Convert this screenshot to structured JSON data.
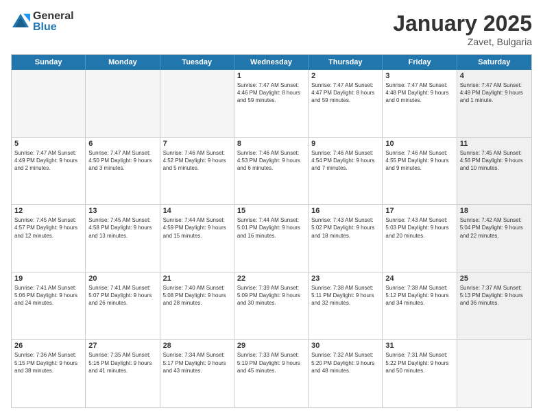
{
  "logo": {
    "general": "General",
    "blue": "Blue"
  },
  "title": "January 2025",
  "subtitle": "Zavet, Bulgaria",
  "days": [
    "Sunday",
    "Monday",
    "Tuesday",
    "Wednesday",
    "Thursday",
    "Friday",
    "Saturday"
  ],
  "weeks": [
    [
      {
        "day": "",
        "info": "",
        "empty": true
      },
      {
        "day": "",
        "info": "",
        "empty": true
      },
      {
        "day": "",
        "info": "",
        "empty": true
      },
      {
        "day": "1",
        "info": "Sunrise: 7:47 AM\nSunset: 4:46 PM\nDaylight: 8 hours\nand 59 minutes."
      },
      {
        "day": "2",
        "info": "Sunrise: 7:47 AM\nSunset: 4:47 PM\nDaylight: 8 hours\nand 59 minutes."
      },
      {
        "day": "3",
        "info": "Sunrise: 7:47 AM\nSunset: 4:48 PM\nDaylight: 9 hours\nand 0 minutes."
      },
      {
        "day": "4",
        "info": "Sunrise: 7:47 AM\nSunset: 4:49 PM\nDaylight: 9 hours\nand 1 minute.",
        "shaded": true
      }
    ],
    [
      {
        "day": "5",
        "info": "Sunrise: 7:47 AM\nSunset: 4:49 PM\nDaylight: 9 hours\nand 2 minutes."
      },
      {
        "day": "6",
        "info": "Sunrise: 7:47 AM\nSunset: 4:50 PM\nDaylight: 9 hours\nand 3 minutes."
      },
      {
        "day": "7",
        "info": "Sunrise: 7:46 AM\nSunset: 4:52 PM\nDaylight: 9 hours\nand 5 minutes."
      },
      {
        "day": "8",
        "info": "Sunrise: 7:46 AM\nSunset: 4:53 PM\nDaylight: 9 hours\nand 6 minutes."
      },
      {
        "day": "9",
        "info": "Sunrise: 7:46 AM\nSunset: 4:54 PM\nDaylight: 9 hours\nand 7 minutes."
      },
      {
        "day": "10",
        "info": "Sunrise: 7:46 AM\nSunset: 4:55 PM\nDaylight: 9 hours\nand 9 minutes."
      },
      {
        "day": "11",
        "info": "Sunrise: 7:45 AM\nSunset: 4:56 PM\nDaylight: 9 hours\nand 10 minutes.",
        "shaded": true
      }
    ],
    [
      {
        "day": "12",
        "info": "Sunrise: 7:45 AM\nSunset: 4:57 PM\nDaylight: 9 hours\nand 12 minutes."
      },
      {
        "day": "13",
        "info": "Sunrise: 7:45 AM\nSunset: 4:58 PM\nDaylight: 9 hours\nand 13 minutes."
      },
      {
        "day": "14",
        "info": "Sunrise: 7:44 AM\nSunset: 4:59 PM\nDaylight: 9 hours\nand 15 minutes."
      },
      {
        "day": "15",
        "info": "Sunrise: 7:44 AM\nSunset: 5:01 PM\nDaylight: 9 hours\nand 16 minutes."
      },
      {
        "day": "16",
        "info": "Sunrise: 7:43 AM\nSunset: 5:02 PM\nDaylight: 9 hours\nand 18 minutes."
      },
      {
        "day": "17",
        "info": "Sunrise: 7:43 AM\nSunset: 5:03 PM\nDaylight: 9 hours\nand 20 minutes."
      },
      {
        "day": "18",
        "info": "Sunrise: 7:42 AM\nSunset: 5:04 PM\nDaylight: 9 hours\nand 22 minutes.",
        "shaded": true
      }
    ],
    [
      {
        "day": "19",
        "info": "Sunrise: 7:41 AM\nSunset: 5:06 PM\nDaylight: 9 hours\nand 24 minutes."
      },
      {
        "day": "20",
        "info": "Sunrise: 7:41 AM\nSunset: 5:07 PM\nDaylight: 9 hours\nand 26 minutes."
      },
      {
        "day": "21",
        "info": "Sunrise: 7:40 AM\nSunset: 5:08 PM\nDaylight: 9 hours\nand 28 minutes."
      },
      {
        "day": "22",
        "info": "Sunrise: 7:39 AM\nSunset: 5:09 PM\nDaylight: 9 hours\nand 30 minutes."
      },
      {
        "day": "23",
        "info": "Sunrise: 7:38 AM\nSunset: 5:11 PM\nDaylight: 9 hours\nand 32 minutes."
      },
      {
        "day": "24",
        "info": "Sunrise: 7:38 AM\nSunset: 5:12 PM\nDaylight: 9 hours\nand 34 minutes."
      },
      {
        "day": "25",
        "info": "Sunrise: 7:37 AM\nSunset: 5:13 PM\nDaylight: 9 hours\nand 36 minutes.",
        "shaded": true
      }
    ],
    [
      {
        "day": "26",
        "info": "Sunrise: 7:36 AM\nSunset: 5:15 PM\nDaylight: 9 hours\nand 38 minutes."
      },
      {
        "day": "27",
        "info": "Sunrise: 7:35 AM\nSunset: 5:16 PM\nDaylight: 9 hours\nand 41 minutes."
      },
      {
        "day": "28",
        "info": "Sunrise: 7:34 AM\nSunset: 5:17 PM\nDaylight: 9 hours\nand 43 minutes."
      },
      {
        "day": "29",
        "info": "Sunrise: 7:33 AM\nSunset: 5:19 PM\nDaylight: 9 hours\nand 45 minutes."
      },
      {
        "day": "30",
        "info": "Sunrise: 7:32 AM\nSunset: 5:20 PM\nDaylight: 9 hours\nand 48 minutes."
      },
      {
        "day": "31",
        "info": "Sunrise: 7:31 AM\nSunset: 5:22 PM\nDaylight: 9 hours\nand 50 minutes."
      },
      {
        "day": "",
        "info": "",
        "empty": true,
        "shaded": true
      }
    ]
  ]
}
